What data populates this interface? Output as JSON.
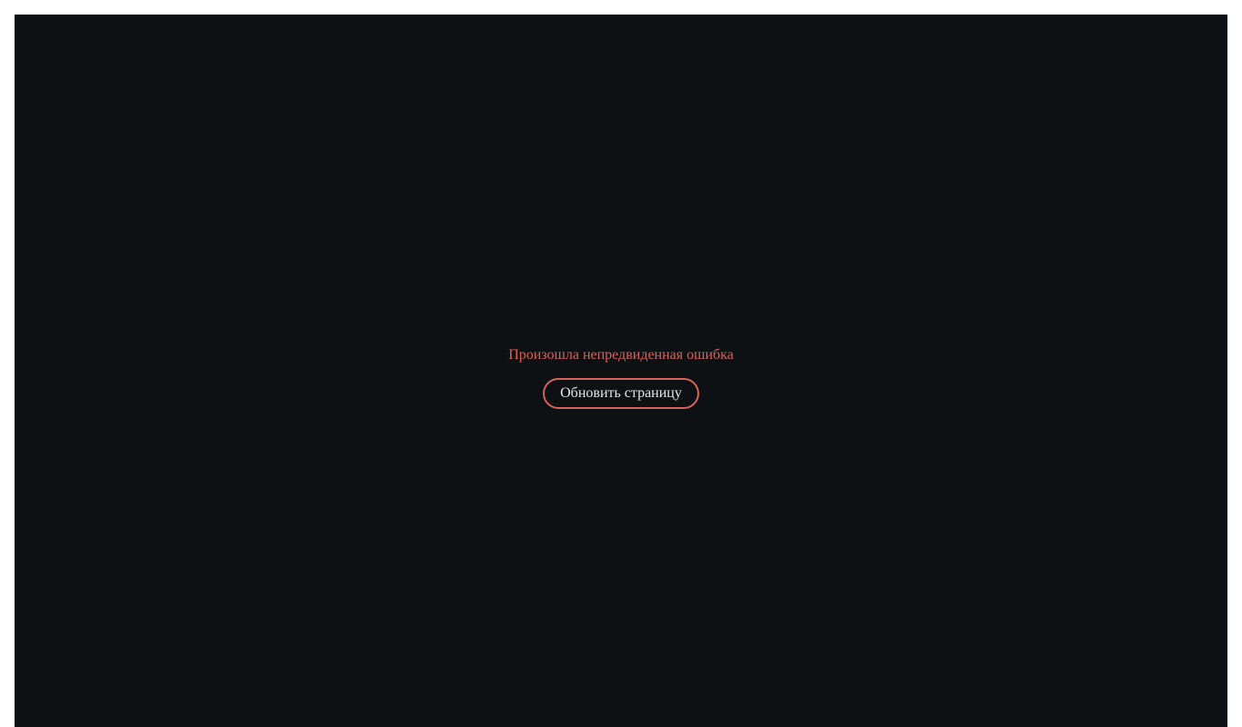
{
  "error": {
    "message": "Произошла непредвиденная ошибка",
    "reload_label": "Обновить страницу"
  },
  "colors": {
    "background": "#0d1114",
    "accent": "#d9625a",
    "button_text": "#e6e6e6"
  }
}
